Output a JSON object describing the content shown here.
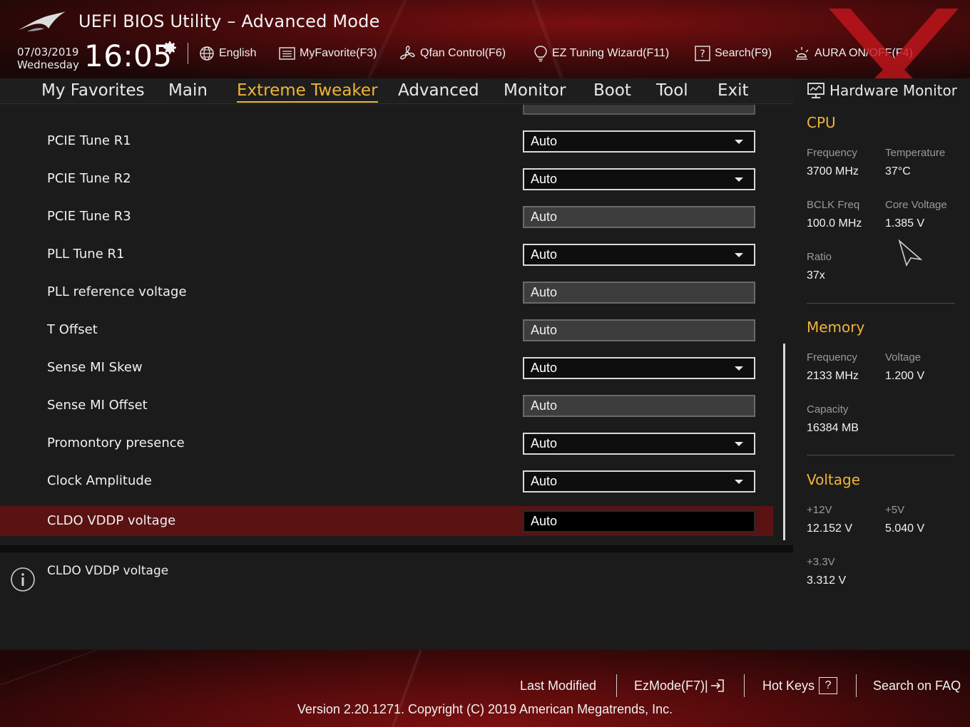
{
  "header": {
    "title": "UEFI BIOS Utility – Advanced Mode",
    "date": "07/03/2019",
    "weekday": "Wednesday",
    "time": "16:05",
    "toolbar": [
      {
        "label": "English",
        "icon": "globe-icon"
      },
      {
        "label": "MyFavorite(F3)",
        "icon": "favorite-list-icon"
      },
      {
        "label": "Qfan Control(F6)",
        "icon": "fan-icon"
      },
      {
        "label": "EZ Tuning Wizard(F11)",
        "icon": "lightbulb-icon"
      },
      {
        "label": "Search(F9)",
        "icon": "help-search-icon"
      },
      {
        "label": "AURA ON/OFF(F4)",
        "icon": "aura-light-icon"
      }
    ]
  },
  "nav": {
    "tabs": [
      "My Favorites",
      "Main",
      "Extreme Tweaker",
      "Advanced",
      "Monitor",
      "Boot",
      "Tool",
      "Exit"
    ],
    "active": "Extreme Tweaker"
  },
  "settings": [
    {
      "label": "PCIE Tune R1",
      "value": "Auto",
      "type": "dropdown"
    },
    {
      "label": "PCIE Tune R2",
      "value": "Auto",
      "type": "dropdown"
    },
    {
      "label": "PCIE Tune R3",
      "value": "Auto",
      "type": "text"
    },
    {
      "label": "PLL Tune R1",
      "value": "Auto",
      "type": "dropdown"
    },
    {
      "label": "PLL reference voltage",
      "value": "Auto",
      "type": "text"
    },
    {
      "label": "T Offset",
      "value": "Auto",
      "type": "text"
    },
    {
      "label": "Sense MI Skew",
      "value": "Auto",
      "type": "dropdown"
    },
    {
      "label": "Sense MI Offset",
      "value": "Auto",
      "type": "text"
    },
    {
      "label": "Promontory presence",
      "value": "Auto",
      "type": "dropdown"
    },
    {
      "label": "Clock Amplitude",
      "value": "Auto",
      "type": "dropdown"
    },
    {
      "label": "CLDO VDDP voltage",
      "value": "Auto",
      "type": "text",
      "selected": true
    }
  ],
  "help": {
    "text": "CLDO VDDP voltage"
  },
  "hardware_monitor": {
    "title": "Hardware Monitor",
    "cpu": {
      "section": "CPU",
      "frequency_label": "Frequency",
      "frequency": "3700 MHz",
      "temperature_label": "Temperature",
      "temperature": "37°C",
      "bclk_label": "BCLK Freq",
      "bclk": "100.0 MHz",
      "core_voltage_label": "Core Voltage",
      "core_voltage": "1.385 V",
      "ratio_label": "Ratio",
      "ratio": "37x"
    },
    "memory": {
      "section": "Memory",
      "frequency_label": "Frequency",
      "frequency": "2133 MHz",
      "voltage_label": "Voltage",
      "voltage": "1.200 V",
      "capacity_label": "Capacity",
      "capacity": "16384 MB"
    },
    "voltage": {
      "section": "Voltage",
      "v12_label": "+12V",
      "v12": "12.152 V",
      "v5_label": "+5V",
      "v5": "5.040 V",
      "v33_label": "+3.3V",
      "v33": "3.312 V"
    }
  },
  "footer": {
    "last_modified": "Last Modified",
    "ezmode": "EzMode(F7)|",
    "hotkeys": "Hot Keys",
    "hotkeys_key": "?",
    "faq": "Search on FAQ",
    "version": "Version 2.20.1271. Copyright (C) 2019 American Megatrends, Inc."
  },
  "colors": {
    "accent": "#f0b43a",
    "selected_row": "#5a1212",
    "brand_red": "#7a0f10"
  }
}
